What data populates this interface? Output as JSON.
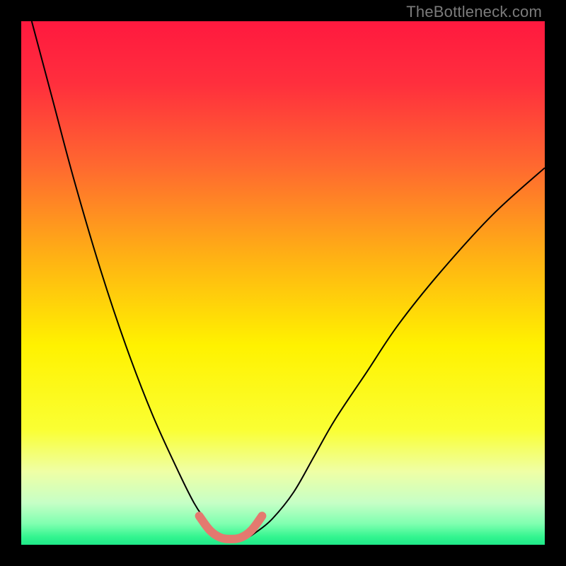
{
  "watermark": "TheBottleneck.com",
  "chart_data": {
    "type": "line",
    "title": "",
    "xlabel": "",
    "ylabel": "",
    "xlim": [
      0,
      100
    ],
    "ylim": [
      0,
      100
    ],
    "background_gradient": {
      "stops": [
        {
          "pos": 0.0,
          "color": "#ff193f"
        },
        {
          "pos": 0.12,
          "color": "#ff2f3d"
        },
        {
          "pos": 0.28,
          "color": "#ff6a2f"
        },
        {
          "pos": 0.45,
          "color": "#ffb114"
        },
        {
          "pos": 0.62,
          "color": "#fff200"
        },
        {
          "pos": 0.78,
          "color": "#faff33"
        },
        {
          "pos": 0.86,
          "color": "#efffa5"
        },
        {
          "pos": 0.92,
          "color": "#c6ffc6"
        },
        {
          "pos": 0.96,
          "color": "#7fffb0"
        },
        {
          "pos": 0.985,
          "color": "#33f58f"
        },
        {
          "pos": 1.0,
          "color": "#1fe889"
        }
      ]
    },
    "series": [
      {
        "name": "bottleneck-curve",
        "stroke": "#000000",
        "stroke_width": 2,
        "x": [
          2,
          6,
          10,
          15,
          20,
          25,
          30,
          33,
          35,
          37,
          39,
          41,
          43,
          45,
          48,
          52,
          56,
          60,
          66,
          72,
          80,
          90,
          100
        ],
        "y": [
          100,
          85,
          70,
          53,
          38,
          25,
          14,
          8,
          5,
          2.5,
          1.3,
          1.0,
          1.3,
          2.5,
          5,
          10,
          17,
          24,
          33,
          42,
          52,
          63,
          72
        ]
      },
      {
        "name": "highlight-band",
        "stroke": "#e4796f",
        "stroke_width": 12,
        "x": [
          34,
          36,
          38,
          40,
          42,
          44,
          46
        ],
        "y": [
          5.5,
          2.8,
          1.4,
          1.1,
          1.4,
          2.8,
          5.5
        ]
      }
    ]
  }
}
